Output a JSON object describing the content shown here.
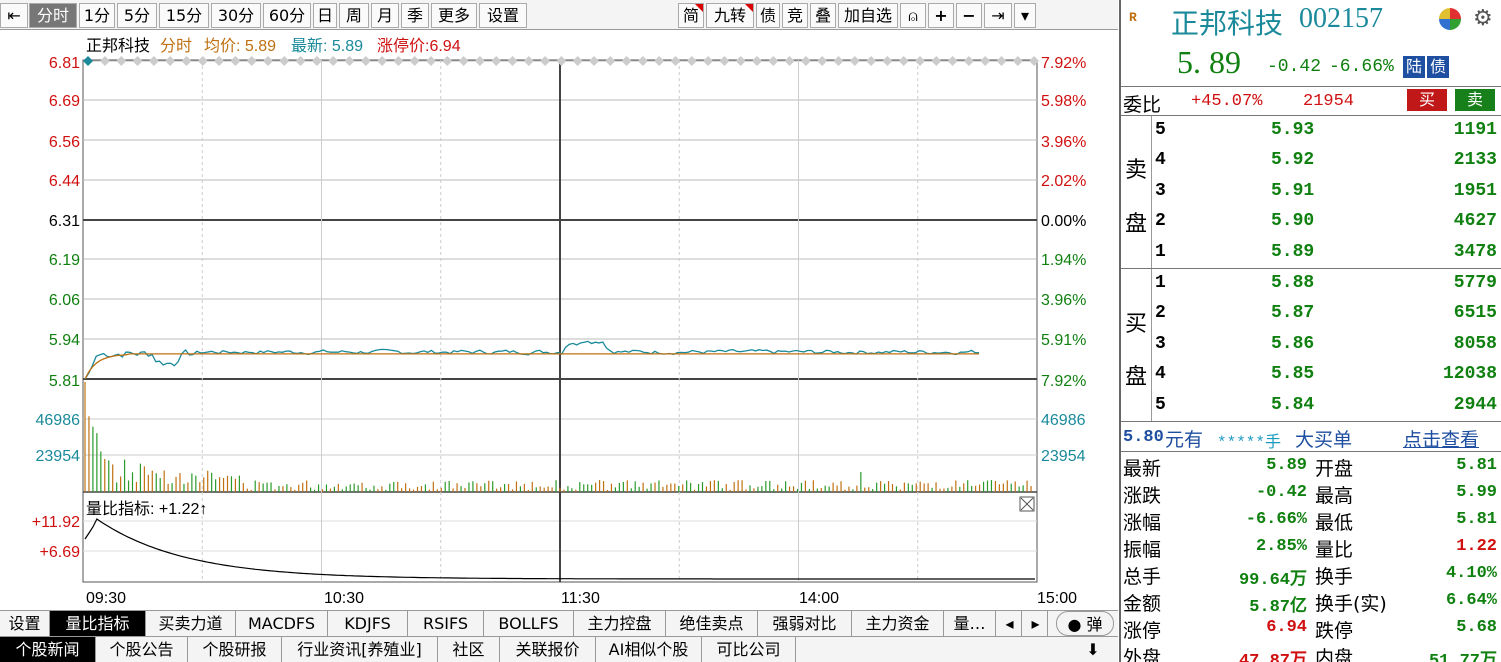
{
  "toolbar": {
    "items": [
      "分时",
      "1分",
      "5分",
      "15分",
      "30分",
      "60分",
      "日",
      "周",
      "月",
      "季",
      "更多",
      "设置"
    ],
    "right_items": [
      "简",
      "九转",
      "债",
      "竞",
      "叠",
      "加自选",
      "⍝",
      "+",
      "−",
      "⇥",
      "▾"
    ]
  },
  "chart": {
    "header_name": "正邦科技",
    "header_mode": "分时",
    "header_avg": "均价: 5.89",
    "header_last": "最新: 5.89",
    "header_limit": "涨停价:6.94",
    "price_labels": [
      "6.81",
      "6.69",
      "6.56",
      "6.44",
      "6.31",
      "6.19",
      "6.06",
      "5.94",
      "5.81"
    ],
    "pct_labels": [
      "7.92%",
      "5.98%",
      "3.96%",
      "2.02%",
      "0.00%",
      "1.94%",
      "3.96%",
      "5.91%",
      "7.92%"
    ],
    "vol_labels": [
      "46986",
      "23954"
    ],
    "ratio_title": "量比指标: +1.22↑",
    "ratio_labels": [
      "+11.92",
      "+6.69"
    ],
    "time_labels": [
      "09:30",
      "10:30",
      "11:30",
      "14:00",
      "15:00"
    ]
  },
  "chart_data": {
    "type": "line",
    "title": "正邦科技 分时",
    "ylim": [
      5.81,
      6.81
    ],
    "x": [
      "09:30",
      "10:30",
      "11:30",
      "14:00",
      "15:00"
    ],
    "series": [
      {
        "name": "最新",
        "values": [
          5.81,
          5.91,
          5.89,
          5.9,
          5.89,
          5.9,
          5.89,
          5.91,
          5.89,
          5.89
        ]
      },
      {
        "name": "均价",
        "values": [
          5.81,
          5.88,
          5.89,
          5.89,
          5.89,
          5.89,
          5.89,
          5.89,
          5.89,
          5.89
        ]
      }
    ]
  },
  "tabs1": [
    "设置",
    "量比指标",
    "买卖力道",
    "MACDFS",
    "KDJFS",
    "RSIFS",
    "BOLLFS",
    "主力控盘",
    "绝佳卖点",
    "强弱对比",
    "主力资金",
    "量…",
    "◂",
    "▸",
    "● 弹"
  ],
  "tabs2": [
    "个股新闻",
    "个股公告",
    "个股研报",
    "行业资讯[养殖业]",
    "社区",
    "关联报价",
    "AI相似个股",
    "可比公司"
  ],
  "quote": {
    "name": "正邦科技",
    "code": "002157",
    "price": "5. 89",
    "change": "-0.42",
    "change_pct": "-6.66%",
    "badge1": "陆",
    "badge2": "债",
    "weibi_label": "委比",
    "weibi_pct": "+45.07%",
    "weibi_vol": "21954",
    "buy_btn": "买",
    "sell_btn": "卖",
    "sell_label": [
      "卖",
      "盘"
    ],
    "buy_label": [
      "买",
      "盘"
    ],
    "asks": [
      {
        "lvl": "5",
        "price": "5.93",
        "vol": "1191"
      },
      {
        "lvl": "4",
        "price": "5.92",
        "vol": "2133"
      },
      {
        "lvl": "3",
        "price": "5.91",
        "vol": "1951"
      },
      {
        "lvl": "2",
        "price": "5.90",
        "vol": "4627"
      },
      {
        "lvl": "1",
        "price": "5.89",
        "vol": "3478"
      }
    ],
    "bids": [
      {
        "lvl": "1",
        "price": "5.88",
        "vol": "5779"
      },
      {
        "lvl": "2",
        "price": "5.87",
        "vol": "6515"
      },
      {
        "lvl": "3",
        "price": "5.86",
        "vol": "8058"
      },
      {
        "lvl": "4",
        "price": "5.85",
        "vol": "12038"
      },
      {
        "lvl": "5",
        "price": "5.84",
        "vol": "2944"
      }
    ],
    "bigbuy": {
      "price": "5.80",
      "text1": "元有",
      "stars": "*****手",
      "text2": "大买单",
      "link": "点击查看"
    },
    "stats": [
      {
        "l1": "最新",
        "v1": "5.89",
        "c1": "green",
        "l2": "开盘",
        "v2": "5.81",
        "c2": "green"
      },
      {
        "l1": "涨跌",
        "v1": "-0.42",
        "c1": "green",
        "l2": "最高",
        "v2": "5.99",
        "c2": "green"
      },
      {
        "l1": "涨幅",
        "v1": "-6.66%",
        "c1": "green",
        "l2": "最低",
        "v2": "5.81",
        "c2": "green"
      },
      {
        "l1": "振幅",
        "v1": "2.85%",
        "c1": "green",
        "l2": "量比",
        "v2": "1.22",
        "c2": "red"
      },
      {
        "l1": "总手",
        "v1": "99.64万",
        "c1": "green",
        "l2": "换手",
        "v2": "4.10%",
        "c2": "green"
      },
      {
        "l1": "金额",
        "v1": "5.87亿",
        "c1": "green",
        "l2": "换手(实)",
        "v2": "6.64%",
        "c2": "green"
      },
      {
        "l1": "涨停",
        "v1": "6.94",
        "c1": "red",
        "l2": "跌停",
        "v2": "5.68",
        "c2": "green"
      },
      {
        "l1": "外盘",
        "v1": "47.87万",
        "c1": "red",
        "l2": "内盘",
        "v2": "51.77万",
        "c2": "green"
      }
    ]
  },
  "colors": {
    "red": "#d01010",
    "green": "#108010",
    "teal": "#1a8a9a",
    "avg": "#c07010"
  }
}
